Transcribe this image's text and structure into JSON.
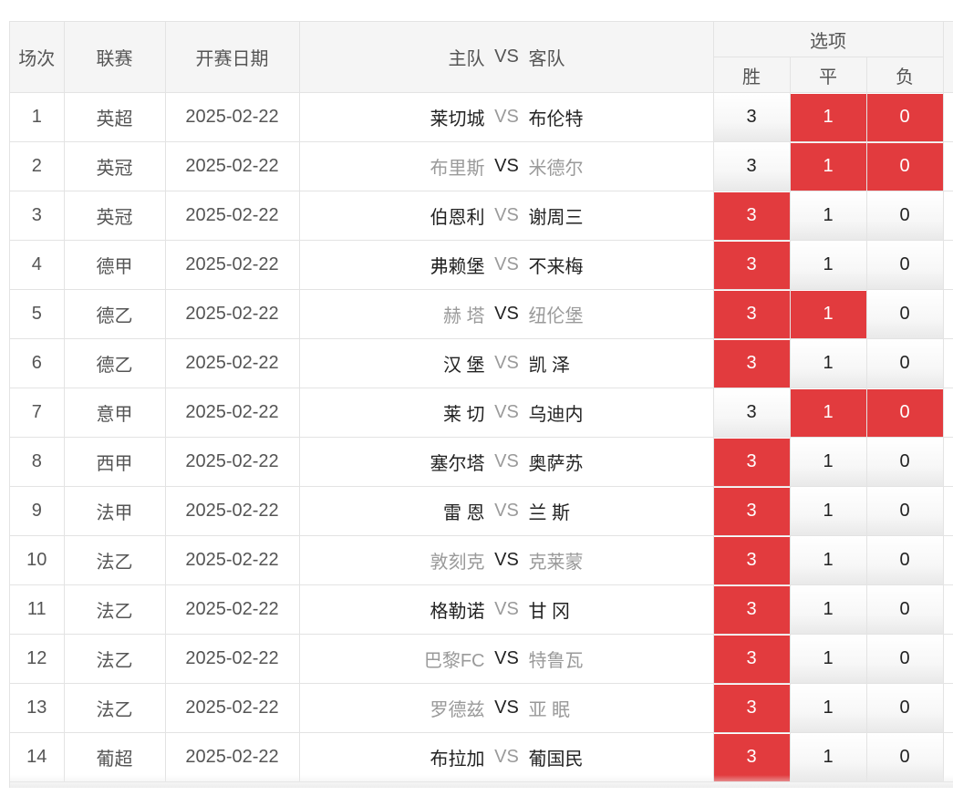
{
  "header": {
    "num": "场次",
    "league": "联赛",
    "date": "开赛日期",
    "home": "主队",
    "vs": "VS",
    "away": "客队",
    "options": "选项",
    "win": "胜",
    "draw": "平",
    "lose": "负"
  },
  "colors": {
    "selected": "#e23b3e",
    "muted_text": "#9a9a9a"
  },
  "rows": [
    {
      "num": "1",
      "league": "英超",
      "date": "2025-02-22",
      "home": "莱切城",
      "vs": "VS",
      "away": "布伦特",
      "muted_side": "vs",
      "win": "3",
      "draw": "1",
      "lose": "0",
      "win_sel": false,
      "draw_sel": true,
      "lose_sel": true
    },
    {
      "num": "2",
      "league": "英冠",
      "date": "2025-02-22",
      "home": "布里斯",
      "vs": "VS",
      "away": "米德尔",
      "muted_side": "teams",
      "win": "3",
      "draw": "1",
      "lose": "0",
      "win_sel": false,
      "draw_sel": true,
      "lose_sel": true
    },
    {
      "num": "3",
      "league": "英冠",
      "date": "2025-02-22",
      "home": "伯恩利",
      "vs": "VS",
      "away": "谢周三",
      "muted_side": "vs",
      "win": "3",
      "draw": "1",
      "lose": "0",
      "win_sel": true,
      "draw_sel": false,
      "lose_sel": false
    },
    {
      "num": "4",
      "league": "德甲",
      "date": "2025-02-22",
      "home": "弗赖堡",
      "vs": "VS",
      "away": "不来梅",
      "muted_side": "vs",
      "win": "3",
      "draw": "1",
      "lose": "0",
      "win_sel": true,
      "draw_sel": false,
      "lose_sel": false
    },
    {
      "num": "5",
      "league": "德乙",
      "date": "2025-02-22",
      "home": "赫 塔",
      "vs": "VS",
      "away": "纽伦堡",
      "muted_side": "teams",
      "win": "3",
      "draw": "1",
      "lose": "0",
      "win_sel": true,
      "draw_sel": true,
      "lose_sel": false
    },
    {
      "num": "6",
      "league": "德乙",
      "date": "2025-02-22",
      "home": "汉 堡",
      "vs": "VS",
      "away": "凯 泽",
      "muted_side": "vs",
      "win": "3",
      "draw": "1",
      "lose": "0",
      "win_sel": true,
      "draw_sel": false,
      "lose_sel": false
    },
    {
      "num": "7",
      "league": "意甲",
      "date": "2025-02-22",
      "home": "莱 切",
      "vs": "VS",
      "away": "乌迪内",
      "muted_side": "vs",
      "win": "3",
      "draw": "1",
      "lose": "0",
      "win_sel": false,
      "draw_sel": true,
      "lose_sel": true
    },
    {
      "num": "8",
      "league": "西甲",
      "date": "2025-02-22",
      "home": "塞尔塔",
      "vs": "VS",
      "away": "奥萨苏",
      "muted_side": "vs",
      "win": "3",
      "draw": "1",
      "lose": "0",
      "win_sel": true,
      "draw_sel": false,
      "lose_sel": false
    },
    {
      "num": "9",
      "league": "法甲",
      "date": "2025-02-22",
      "home": "雷 恩",
      "vs": "VS",
      "away": "兰 斯",
      "muted_side": "vs",
      "win": "3",
      "draw": "1",
      "lose": "0",
      "win_sel": true,
      "draw_sel": false,
      "lose_sel": false
    },
    {
      "num": "10",
      "league": "法乙",
      "date": "2025-02-22",
      "home": "敦刻克",
      "vs": "VS",
      "away": "克莱蒙",
      "muted_side": "teams",
      "win": "3",
      "draw": "1",
      "lose": "0",
      "win_sel": true,
      "draw_sel": false,
      "lose_sel": false
    },
    {
      "num": "11",
      "league": "法乙",
      "date": "2025-02-22",
      "home": "格勒诺",
      "vs": "VS",
      "away": "甘 冈",
      "muted_side": "vs",
      "win": "3",
      "draw": "1",
      "lose": "0",
      "win_sel": true,
      "draw_sel": false,
      "lose_sel": false
    },
    {
      "num": "12",
      "league": "法乙",
      "date": "2025-02-22",
      "home": "巴黎FC",
      "vs": "VS",
      "away": "特鲁瓦",
      "muted_side": "teams",
      "win": "3",
      "draw": "1",
      "lose": "0",
      "win_sel": true,
      "draw_sel": false,
      "lose_sel": false
    },
    {
      "num": "13",
      "league": "法乙",
      "date": "2025-02-22",
      "home": "罗德兹",
      "vs": "VS",
      "away": "亚 眠",
      "muted_side": "teams",
      "win": "3",
      "draw": "1",
      "lose": "0",
      "win_sel": true,
      "draw_sel": false,
      "lose_sel": false
    },
    {
      "num": "14",
      "league": "葡超",
      "date": "2025-02-22",
      "home": "布拉加",
      "vs": "VS",
      "away": "葡国民",
      "muted_side": "vs",
      "win": "3",
      "draw": "1",
      "lose": "0",
      "win_sel": true,
      "draw_sel": false,
      "lose_sel": false
    }
  ]
}
